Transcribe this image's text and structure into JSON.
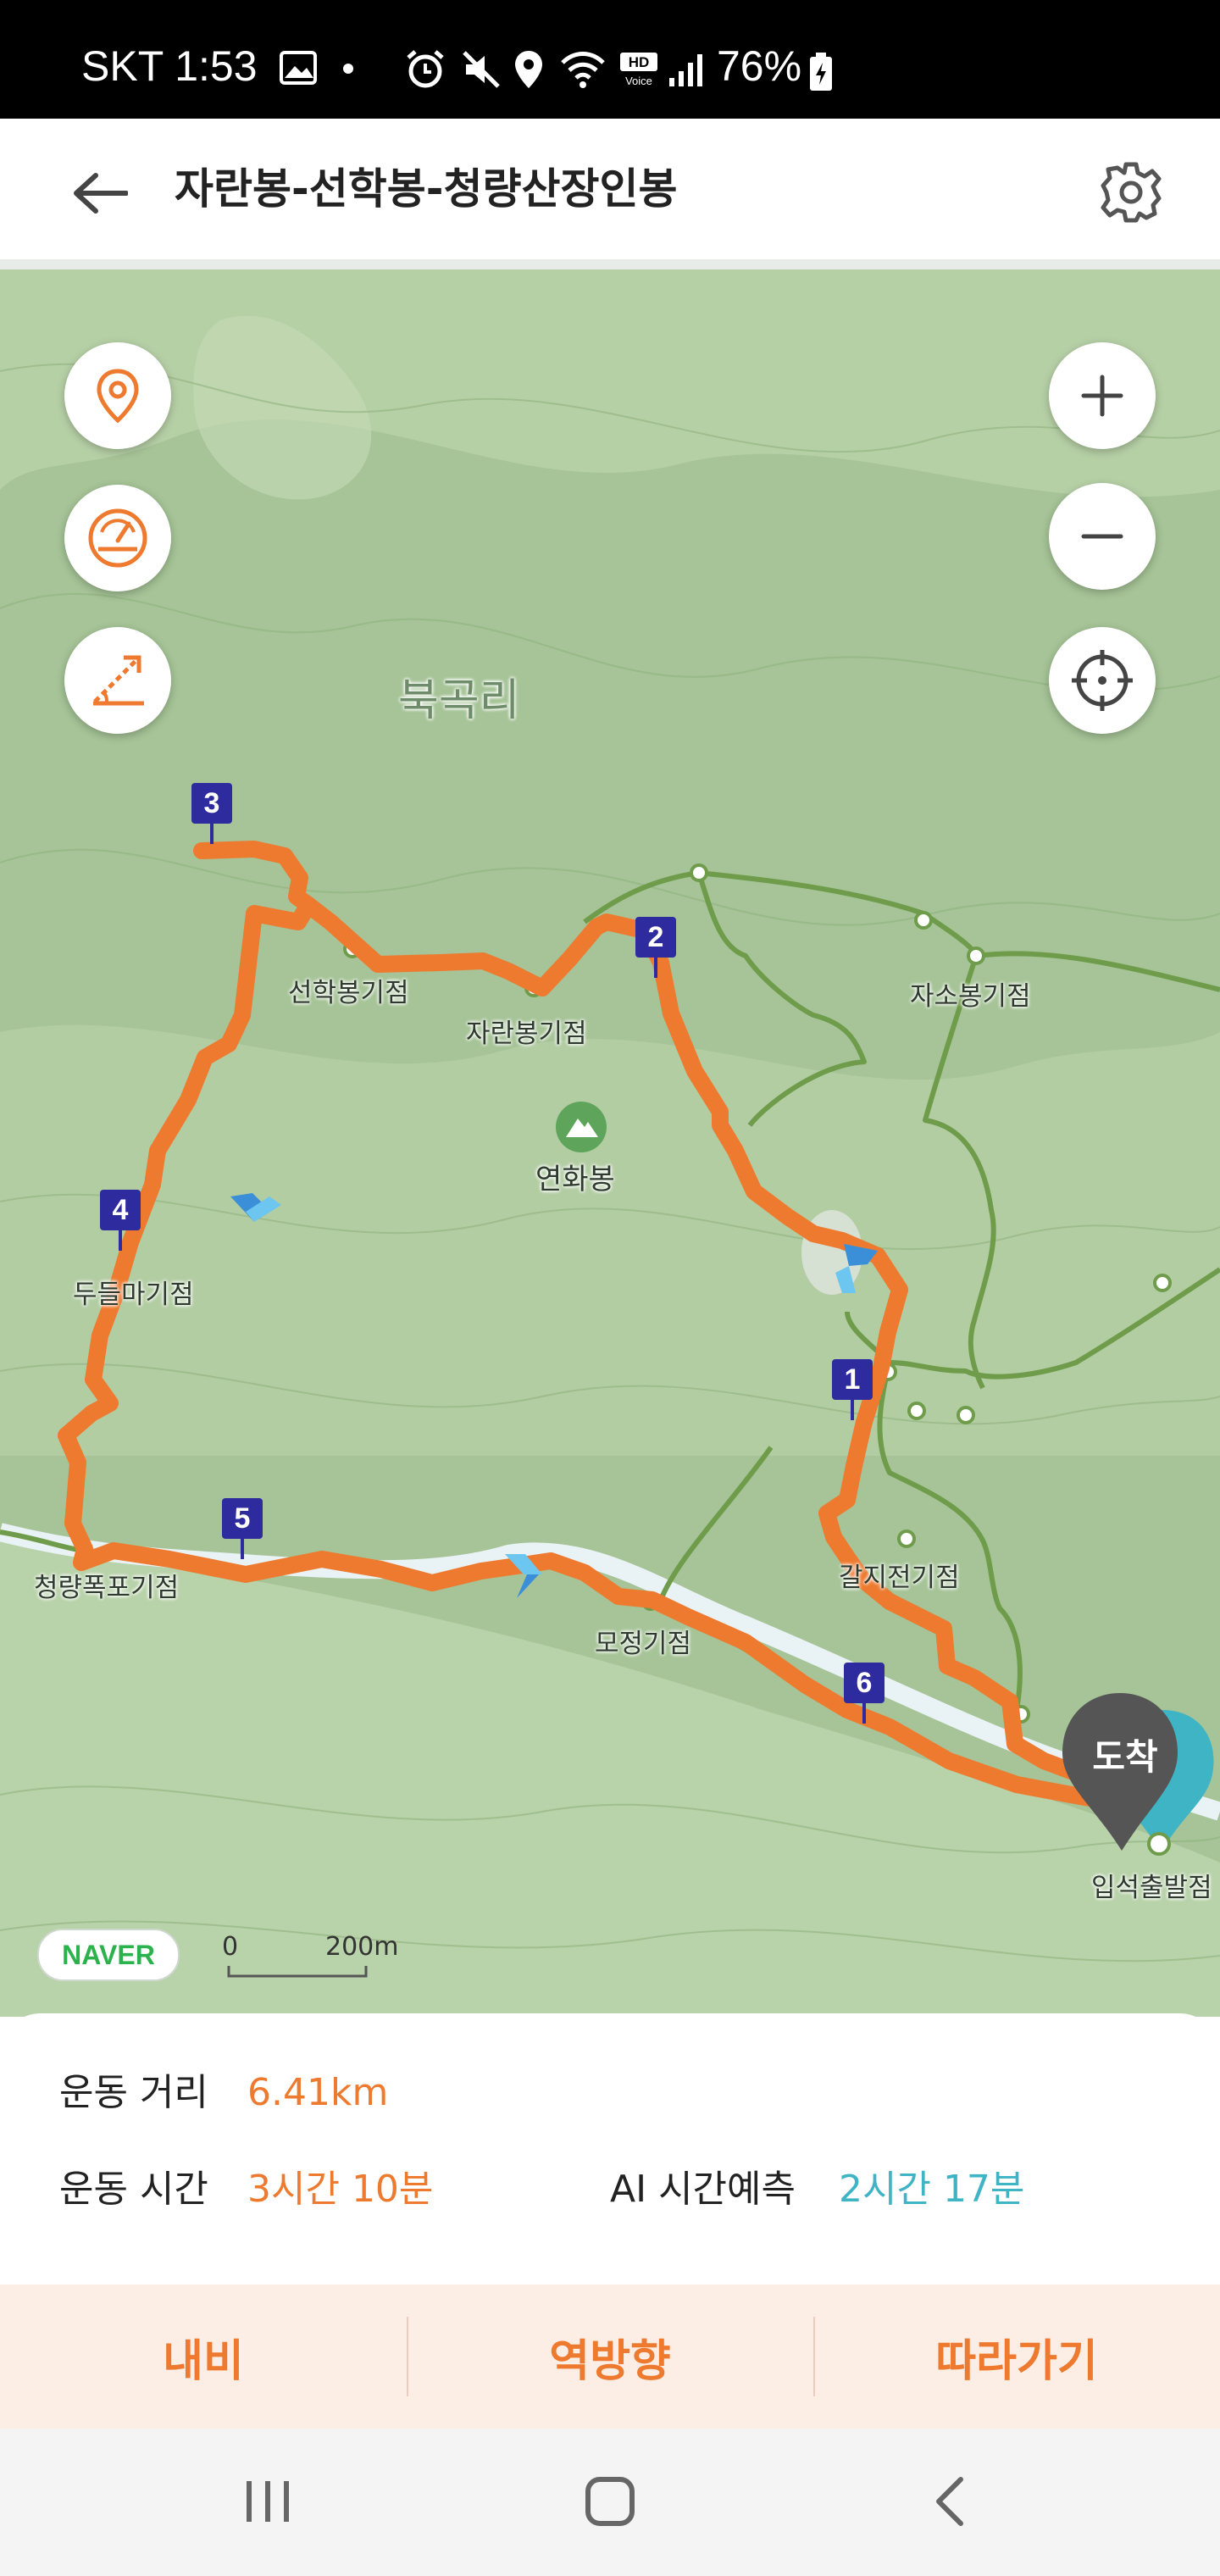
{
  "status_bar": {
    "carrier_time": "SKT 1:53",
    "battery": "76%"
  },
  "header": {
    "title": "자란봉-선학봉-청량산장인봉",
    "back_icon": "arrow-left-icon",
    "settings_icon": "gear-icon"
  },
  "map": {
    "village_label": "북곡리",
    "labels": {
      "seonhak": "선학봉기점",
      "jaran": "자란봉기점",
      "yeonhwa": "연화봉",
      "jaso": "자소봉기점",
      "dumaegi": "두들마기점",
      "cheongryang": "청량폭포기점",
      "mojeong": "모정기점",
      "jigi": "갈지전기점",
      "ipseok": "입석출발점"
    },
    "markers": [
      "1",
      "2",
      "3",
      "4",
      "5",
      "6"
    ],
    "arrival_label": "도착",
    "naver_logo": "NAVER",
    "scale_zero": "0",
    "scale_distance": "200m",
    "route_color": "#ee7a2f"
  },
  "controls": {
    "zoom_in": "plus-icon",
    "zoom_out": "minus-icon",
    "current_location": "crosshair-icon"
  },
  "stats": {
    "distance_label": "운동 거리",
    "distance_value": "6.41km",
    "time_label": "운동 시간",
    "time_value": "3시간 10분",
    "ai_label": "AI 시간예측",
    "ai_value": "2시간 17분"
  },
  "actions": {
    "navigate": "내비",
    "reverse": "역방향",
    "follow": "따라가기"
  },
  "colors": {
    "accent": "#ee7a2f",
    "ai": "#3fb4c4",
    "marker": "#2d2b9e"
  }
}
